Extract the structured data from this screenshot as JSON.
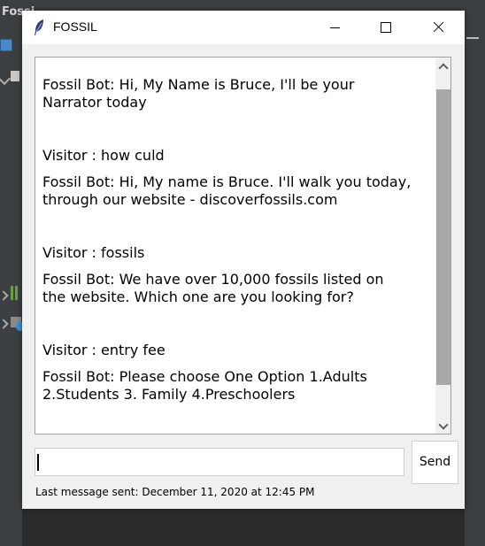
{
  "background": {
    "ide_title": "Fossi"
  },
  "window": {
    "title": "FOSSIL",
    "icon": "feather-icon"
  },
  "chat": {
    "messages": [
      {
        "text": "Fossil Bot: Hi, My Name is Bruce, I'll be your\nNarrator today"
      },
      {
        "text": "Visitor : how culd"
      },
      {
        "text": "Fossil Bot: Hi, My name is Bruce. I'll walk you today,\nthrough our website - discoverfossils.com"
      },
      {
        "text": "Visitor : fossils"
      },
      {
        "text": "Fossil Bot: We have over 10,000 fossils listed on\nthe website. Which one are you looking for?"
      },
      {
        "text": "Visitor : entry fee"
      },
      {
        "text": "Fossil Bot: Please choose One Option 1.Adults\n2.Students 3. Family 4.Preschoolers"
      }
    ]
  },
  "input": {
    "value": ""
  },
  "send_label": "Send",
  "status": "Last message sent: December 11, 2020 at 12:45 PM"
}
